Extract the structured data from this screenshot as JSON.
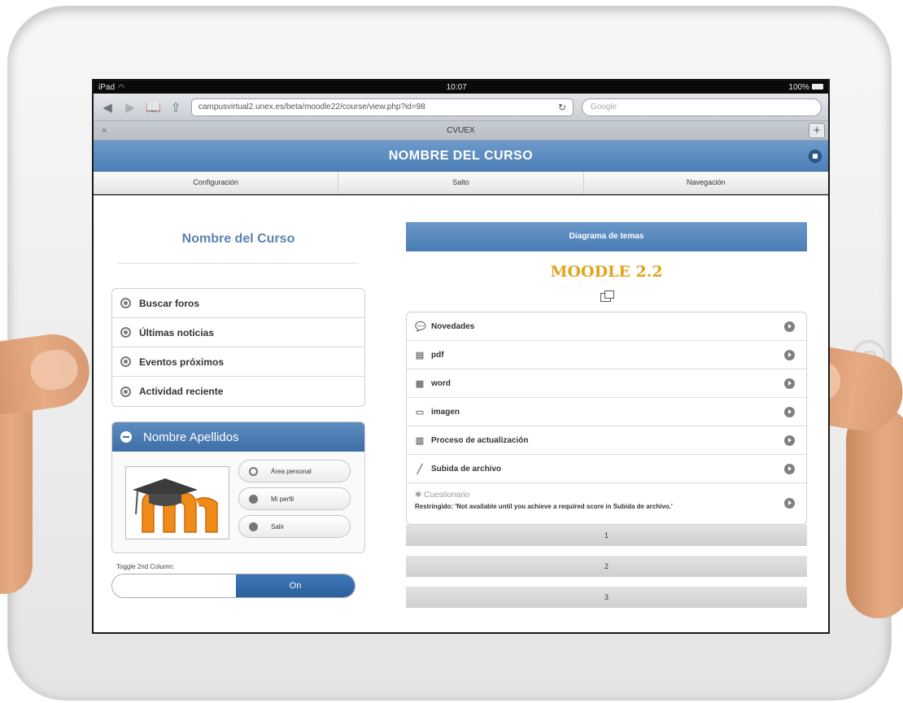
{
  "statusbar": {
    "device": "iPad",
    "time": "10:07",
    "battery": "100%"
  },
  "browser": {
    "url": "campusvirtual2.unex.es/beta/moodle22/course/view.php?id=98",
    "search_placeholder": "Google",
    "tab_title": "CVUEX",
    "tab_close": "×",
    "tab_add": "+"
  },
  "header": {
    "title": "NOMBRE DEL CURSO"
  },
  "menu": [
    "Configuración",
    "Salto",
    "Navegación"
  ],
  "left": {
    "course_title": "Nombre del Curso",
    "blocks": [
      "Buscar foros",
      "Últimas noticias",
      "Eventos próximos",
      "Actividad reciente"
    ],
    "user_block": {
      "name": "Nombre Apellidos",
      "buttons": [
        "Área personal",
        "Mi perfil",
        "Salir"
      ]
    },
    "toggle_label": "Toggle 2nd Column:",
    "toggle_value": "On"
  },
  "right": {
    "diagram_header": "Diagrama de temas",
    "course_heading": "MOODLE 2.2",
    "activities": [
      {
        "label": "Novedades",
        "icon": "forum-icon"
      },
      {
        "label": "pdf",
        "icon": "pdf-icon"
      },
      {
        "label": "word",
        "icon": "word-icon"
      },
      {
        "label": "imagen",
        "icon": "image-icon"
      },
      {
        "label": "Proceso de actualización",
        "icon": "resource-icon"
      },
      {
        "label": "Subida de archivo",
        "icon": "assignment-icon"
      }
    ],
    "restricted_activity": {
      "label": "Cuestionario",
      "note": "Restringido: 'Not available until you achieve a required score in Subida de archivo.'"
    },
    "sections": [
      "1",
      "2",
      "3"
    ]
  },
  "colors": {
    "accent": "#4d7fb6",
    "moodle_orange": "#e0a41c"
  }
}
